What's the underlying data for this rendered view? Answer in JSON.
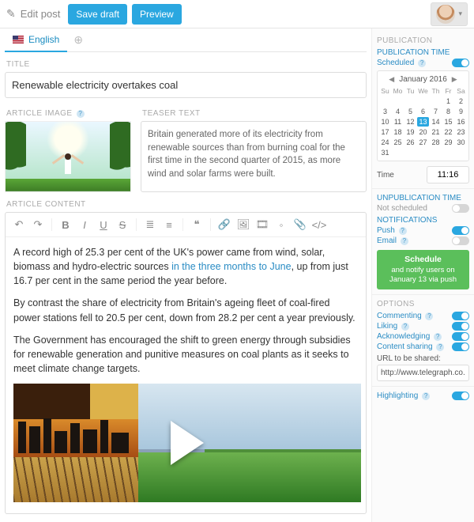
{
  "topbar": {
    "edit_label": "Edit post",
    "save_draft": "Save draft",
    "preview": "Preview"
  },
  "lang": {
    "tab_label": "English"
  },
  "labels": {
    "title": "TITLE",
    "article_image": "ARTICLE IMAGE",
    "teaser_text": "TEASER TEXT",
    "article_content": "ARTICLE CONTENT"
  },
  "title_value": "Renewable electricity overtakes coal",
  "teaser_value": "Britain generated more of its electricity from renewable sources than from burning coal for the first time in the second quarter of 2015, as more wind and solar farms were built.",
  "content": {
    "p1a": "A record high of 25.3 per cent of the UK's power came from wind, solar, biomass and hydro-electric sources ",
    "p1link": "in the three months to June",
    "p1b": ", up from just 16.7 per cent in the same period the year before.",
    "p2": "By contrast the share of electricity from Britain's ageing fleet of coal-fired power stations fell to 20.5 per cent, down from 28.2 per cent a year previously.",
    "p3": "The Government has encouraged the shift to green energy through subsidies for renewable generation and punitive measures on coal plants as it seeks to meet climate change targets."
  },
  "sidebar": {
    "publication": "PUBLICATION",
    "publication_time": "PUBLICATION TIME",
    "scheduled": "Scheduled",
    "month_label": "January  2016",
    "dow": [
      "Su",
      "Mo",
      "Tu",
      "We",
      "Th",
      "Fr",
      "Sa"
    ],
    "days": [
      {
        "n": "",
        "dim": true
      },
      {
        "n": "",
        "dim": true
      },
      {
        "n": "",
        "dim": true
      },
      {
        "n": "",
        "dim": true
      },
      {
        "n": "",
        "dim": true
      },
      {
        "n": "1"
      },
      {
        "n": "2"
      },
      {
        "n": "3"
      },
      {
        "n": "4"
      },
      {
        "n": "5"
      },
      {
        "n": "6"
      },
      {
        "n": "7"
      },
      {
        "n": "8"
      },
      {
        "n": "9"
      },
      {
        "n": "10"
      },
      {
        "n": "11"
      },
      {
        "n": "12"
      },
      {
        "n": "13",
        "sel": true
      },
      {
        "n": "14"
      },
      {
        "n": "15"
      },
      {
        "n": "16"
      },
      {
        "n": "17"
      },
      {
        "n": "18"
      },
      {
        "n": "19"
      },
      {
        "n": "20"
      },
      {
        "n": "21"
      },
      {
        "n": "22"
      },
      {
        "n": "23"
      },
      {
        "n": "24"
      },
      {
        "n": "25"
      },
      {
        "n": "26"
      },
      {
        "n": "27"
      },
      {
        "n": "28"
      },
      {
        "n": "29"
      },
      {
        "n": "30"
      },
      {
        "n": "31"
      },
      {
        "n": "",
        "dim": true
      },
      {
        "n": "",
        "dim": true
      },
      {
        "n": "",
        "dim": true
      },
      {
        "n": "",
        "dim": true
      },
      {
        "n": "",
        "dim": true
      },
      {
        "n": "",
        "dim": true
      }
    ],
    "time_label": "Time",
    "time_value": "11:16",
    "unpublication_time": "UNPUBLICATION TIME",
    "not_scheduled": "Not scheduled",
    "notifications": "NOTIFICATIONS",
    "push": "Push",
    "email": "Email",
    "schedule_btn_title": "Schedule",
    "schedule_btn_sub": "and notify users on January 13 via push",
    "options": "OPTIONS",
    "commenting": "Commenting",
    "liking": "Liking",
    "acknowledging": "Acknowledging",
    "content_sharing": "Content sharing",
    "url_label": "URL to be shared:",
    "url_value": "http://www.telegraph.co.u",
    "highlighting": "Highlighting"
  }
}
